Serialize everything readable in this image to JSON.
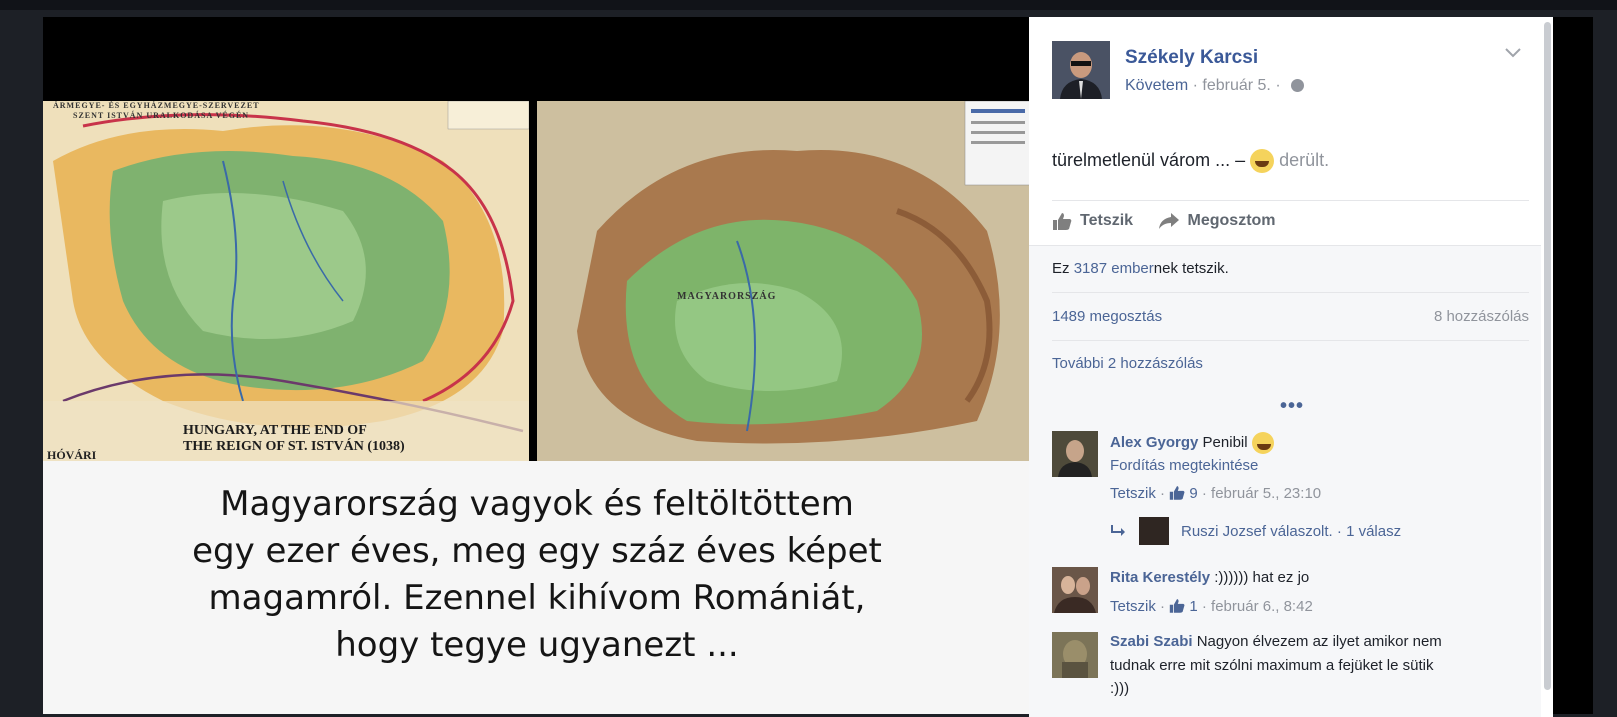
{
  "post": {
    "author": "Székely Karcsi",
    "follow": "Követem",
    "date": "február 5.",
    "dot": "·",
    "status_text": "türelmetlenül várom ... –",
    "feeling": "derült.",
    "actions": {
      "like": "Tetszik",
      "share": "Megosztom"
    },
    "likes_prefix": "Ez",
    "likes_count": "3187",
    "likes_people": "ember",
    "likes_suffix": "nek tetszik.",
    "shares": "1489 megosztás",
    "comments_count": "8 hozzászólás",
    "more_comments": "További 2 hozzászólás",
    "dots": "•••"
  },
  "media": {
    "left_caption_line1": "HUNGARY, AT THE END OF",
    "left_caption_line2": "THE REIGN OF ST. ISTVÁN (1038)",
    "left_corner": "HÓVÁRI",
    "left_header_1": "ÁRMEGYE- ÉS EGYHÁZMEGYE-SZERVEZET",
    "left_header_2": "SZENT ISTVÁN URALKODÁSA VÉGÉN",
    "right_label": "MAGYARORSZÁG",
    "lines": [
      "Magyarország vagyok és feltöltöttem",
      "egy ezer éves, meg egy száz éves képet",
      "magamról. Ezennel kihívom Romániát,",
      "hogy tegye ugyanezt ..."
    ]
  },
  "comments": [
    {
      "name": "Alex Gyorgy",
      "text": "Penibil",
      "translate": "Fordítás megtekintése",
      "like": "Tetszik",
      "count": "9",
      "time": "február 5., 23:10"
    },
    {
      "name": "Rita Kerestély",
      "text": ":)))))) hat ez jo",
      "like": "Tetszik",
      "count": "1",
      "time": "február 6., 8:42"
    },
    {
      "name": "Szabi Szabi",
      "text_line1": "Nagyon élvezem az ilyet amikor nem",
      "text_line2": "tudnak erre mit szólni maximum a fejüket le sütik",
      "text_line3": ":)))"
    }
  ],
  "reply": {
    "text": "Ruszi Jozsef válaszolt.",
    "count": "1 válasz"
  },
  "colors": {
    "link": "#4b6596",
    "author": "#3b5998",
    "meta": "#90949c"
  }
}
